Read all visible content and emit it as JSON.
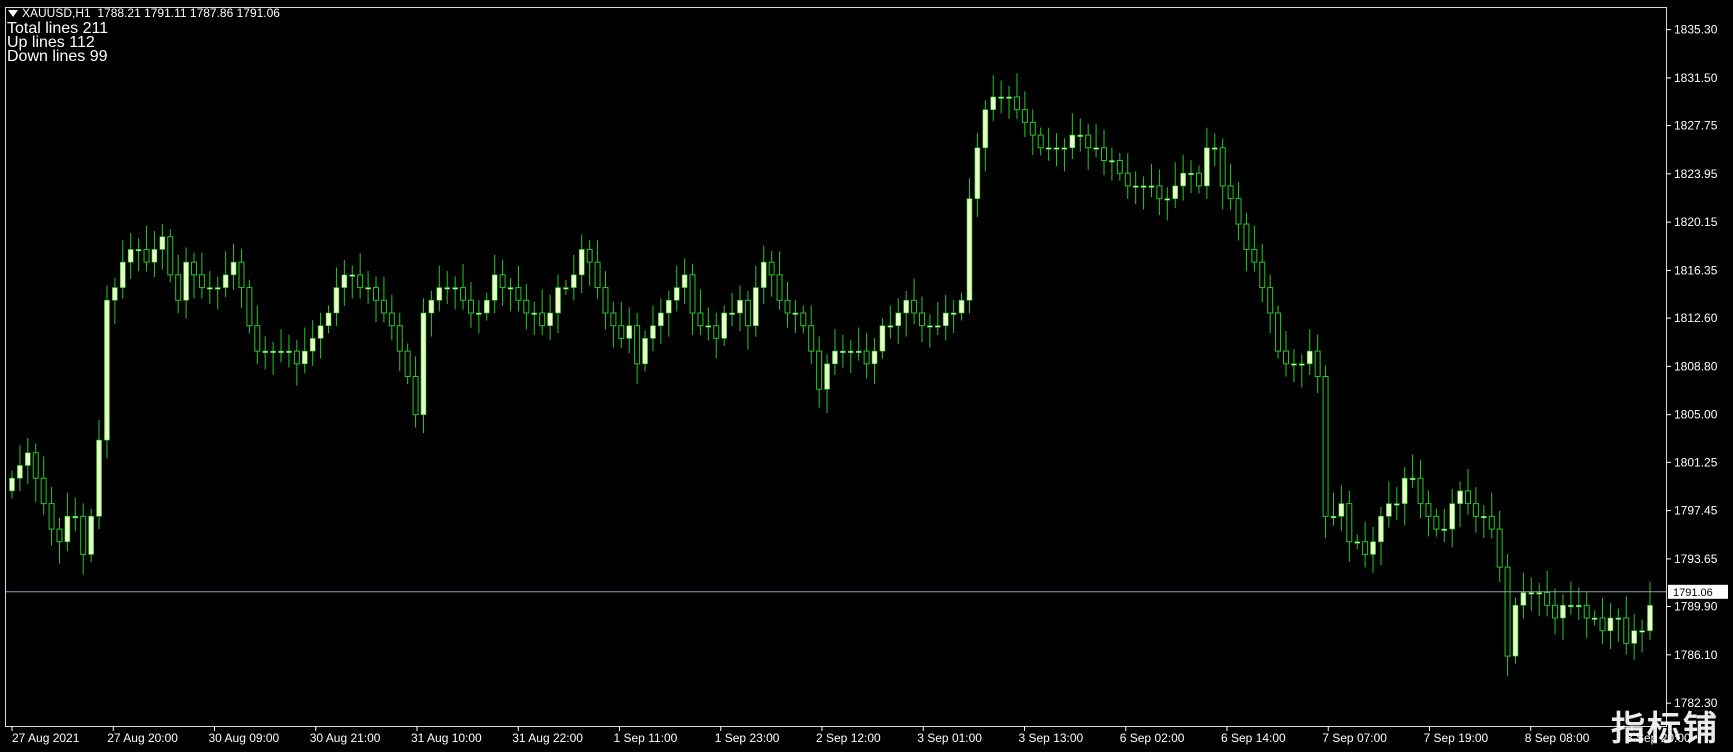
{
  "header": {
    "symbol": "XAUUSD,H1",
    "ohlc": "1788.21 1791.11 1787.86 1791.06"
  },
  "stats": {
    "total": "Total lines 211",
    "up": "Up lines 112",
    "down": "Down lines 99"
  },
  "watermark": "指标铺",
  "colors": {
    "background": "#000000",
    "bull_body": "#eaffc8",
    "wick": "#22c922",
    "up_line": "#ff2fd6",
    "down_line": "#1aa6f2",
    "bid_line": "#8aa2b8",
    "axis": "#ffffff"
  },
  "chart_data": {
    "type": "candlestick",
    "symbol": "XAUUSD",
    "timeframe": "H1",
    "ylim": [
      1780.5,
      1837.0
    ],
    "y_ticks": [
      "1835.30",
      "1831.50",
      "1827.75",
      "1823.95",
      "1820.15",
      "1816.35",
      "1812.60",
      "1808.80",
      "1805.00",
      "1801.25",
      "1797.45",
      "1793.65",
      "1789.90",
      "1786.10",
      "1782.30"
    ],
    "x_ticks": [
      "27 Aug 2021",
      "27 Aug 20:00",
      "30 Aug 09:00",
      "30 Aug 21:00",
      "31 Aug 10:00",
      "31 Aug 22:00",
      "1 Sep 11:00",
      "1 Sep 23:00",
      "2 Sep 12:00",
      "3 Sep 01:00",
      "3 Sep 13:00",
      "6 Sep 02:00",
      "6 Sep 14:00",
      "7 Sep 07:00",
      "7 Sep 19:00",
      "8 Sep 08:00",
      "8 Sep 20:00"
    ],
    "current_price": "1791.06",
    "close": [
      1800,
      1801,
      1802,
      1800,
      1798,
      1796,
      1795,
      1797,
      1797,
      1794,
      1797,
      1803,
      1814,
      1815,
      1817,
      1818,
      1818,
      1817,
      1818,
      1819,
      1816,
      1814,
      1817,
      1816,
      1815,
      1815,
      1815,
      1816,
      1817,
      1815,
      1812,
      1810,
      1810,
      1810,
      1810,
      1810,
      1809,
      1810,
      1811,
      1812,
      1813,
      1815,
      1816,
      1816,
      1815,
      1815,
      1814,
      1813,
      1812,
      1810,
      1808,
      1805,
      1813,
      1814,
      1815,
      1815,
      1815,
      1814,
      1813,
      1813,
      1814,
      1816,
      1815,
      1815,
      1814,
      1813,
      1813,
      1812,
      1813,
      1815,
      1815,
      1816,
      1818,
      1817,
      1815,
      1813,
      1812,
      1811,
      1812,
      1809,
      1811,
      1812,
      1813,
      1814,
      1815,
      1816,
      1813,
      1812,
      1812,
      1811,
      1813,
      1813,
      1814,
      1812,
      1815,
      1817,
      1816,
      1814,
      1813,
      1813,
      1812,
      1810,
      1807,
      1809,
      1810,
      1810,
      1810,
      1810,
      1809,
      1810,
      1812,
      1812,
      1813,
      1814,
      1813,
      1812,
      1812,
      1812,
      1813,
      1813,
      1814,
      1822,
      1826,
      1829,
      1830,
      1830,
      1830,
      1829,
      1828,
      1827,
      1826,
      1826,
      1826,
      1826,
      1827,
      1827,
      1826,
      1826,
      1825,
      1825,
      1824,
      1823,
      1823,
      1823,
      1823,
      1822,
      1822,
      1823,
      1824,
      1824,
      1823,
      1826,
      1826,
      1823,
      1822,
      1820,
      1818,
      1817,
      1815,
      1813,
      1810,
      1809,
      1809,
      1809,
      1810,
      1808,
      1797,
      1797,
      1798,
      1795,
      1795,
      1794,
      1795,
      1797,
      1798,
      1798,
      1800,
      1800,
      1798,
      1797,
      1796,
      1796,
      1798,
      1799,
      1798,
      1797,
      1797,
      1796,
      1793,
      1786,
      1790,
      1791,
      1791,
      1791,
      1790,
      1789,
      1790,
      1790,
      1790,
      1789,
      1789,
      1788,
      1789,
      1789,
      1787,
      1788,
      1788,
      1790
    ]
  }
}
